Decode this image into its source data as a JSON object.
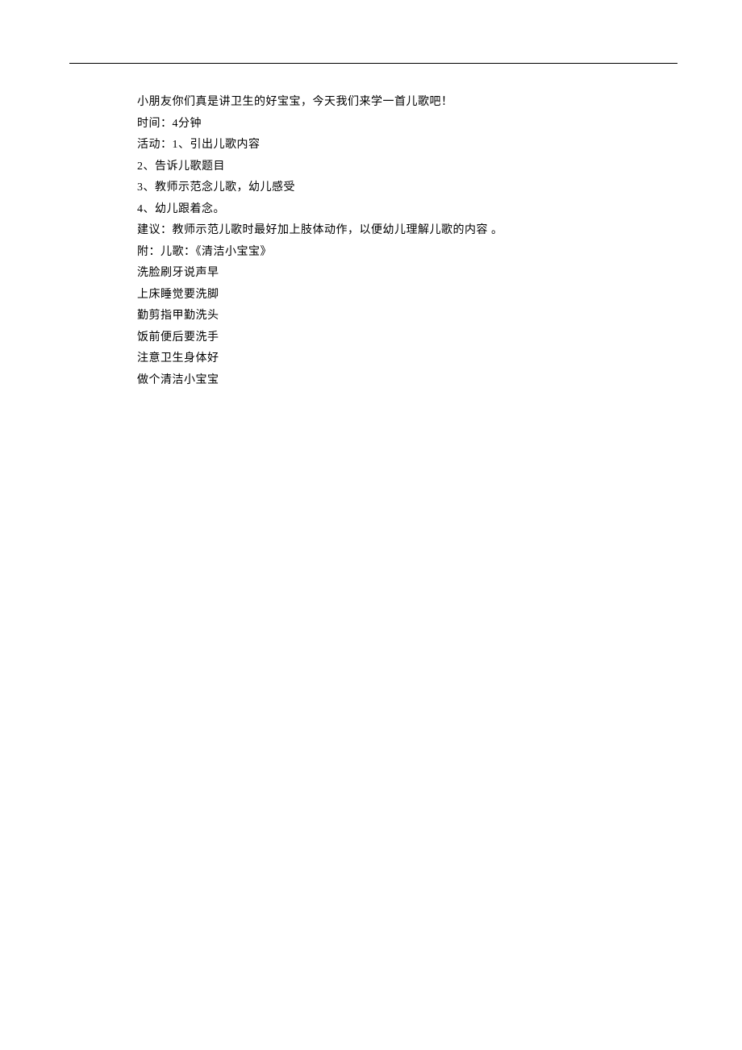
{
  "lines": [
    "小朋友你们真是讲卫生的好宝宝，今天我们来学一首儿歌吧！",
    "时间：4分钟",
    "活动：1、引出儿歌内容",
    "2、告诉儿歌题目",
    "3、教师示范念儿歌，幼儿感受",
    "4、幼儿跟着念。",
    "建议：教师示范儿歌时最好加上肢体动作，以便幼儿理解儿歌的内容 。",
    "附：儿歌：《清洁小宝宝》",
    "洗脸刷牙说声早",
    "上床睡觉要洗脚",
    "勤剪指甲勤洗头",
    "饭前便后要洗手",
    "注意卫生身体好",
    "做个清洁小宝宝"
  ]
}
